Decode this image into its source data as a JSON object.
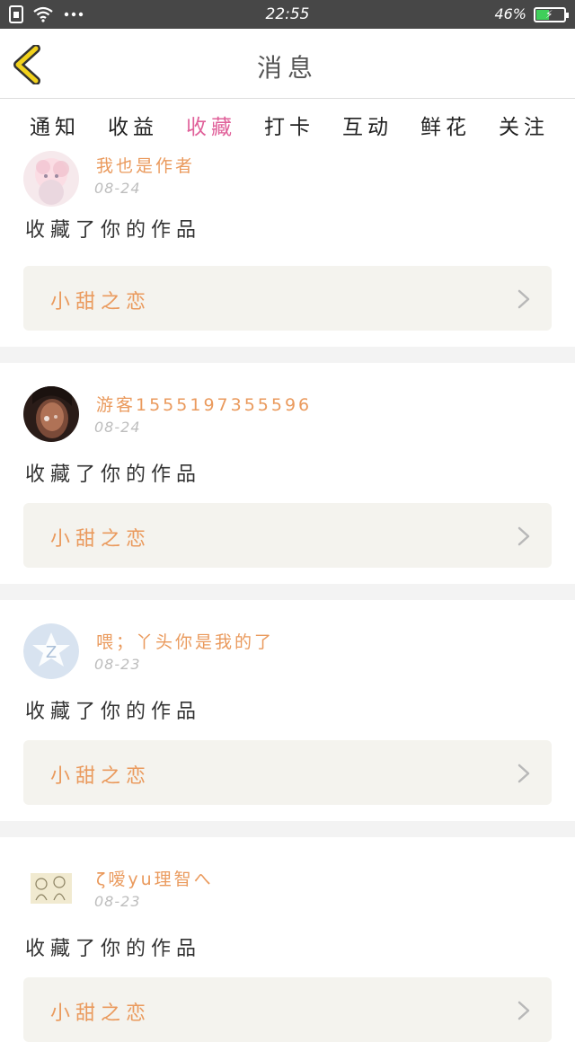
{
  "status_bar": {
    "time": "22:55",
    "battery_percent": "46%",
    "battery_level": 0.46,
    "icons": [
      "sim-icon",
      "wifi-icon",
      "more-icon",
      "battery-charging-icon"
    ]
  },
  "header": {
    "title": "消息",
    "back_icon": "chevron-left-icon"
  },
  "tabs": [
    {
      "label": "通知",
      "active": false
    },
    {
      "label": "收益",
      "active": false
    },
    {
      "label": "收藏",
      "active": true
    },
    {
      "label": "打卡",
      "active": false
    },
    {
      "label": "互动",
      "active": false
    },
    {
      "label": "鲜花",
      "active": false
    },
    {
      "label": "关注",
      "active": false
    }
  ],
  "feed": [
    {
      "username": "我也是作者",
      "date": "08-24",
      "action": "收藏了你的作品",
      "work_title": "小甜之恋",
      "avatar": "anime-girl-avatar"
    },
    {
      "username": "游客1555197355596",
      "date": "08-24",
      "action": "收藏了你的作品",
      "work_title": "小甜之恋",
      "avatar": "photo-avatar"
    },
    {
      "username": "喂；丫头你是我的了",
      "date": "08-23",
      "action": "收藏了你的作品",
      "work_title": "小甜之恋",
      "avatar": "qq-default-avatar"
    },
    {
      "username": "ζ嗳yu理智へ",
      "date": "08-23",
      "action": "收藏了你的作品",
      "work_title": "小甜之恋",
      "avatar": "sketch-avatar"
    }
  ],
  "colors": {
    "accent_pink": "#e0619a",
    "username_orange": "#ea9a5d",
    "back_yellow": "#f2d21c",
    "status_bar_bg": "#474747"
  }
}
